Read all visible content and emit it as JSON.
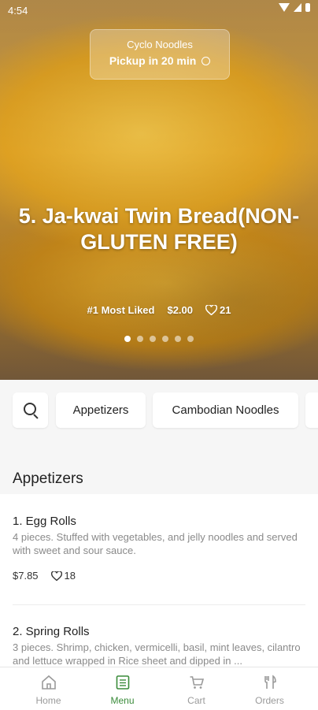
{
  "status_bar": {
    "time": "4:54"
  },
  "pickup": {
    "restaurant": "Cyclo Noodles",
    "time_label": "Pickup in 20 min"
  },
  "featured": {
    "title": "5. Ja-kwai Twin Bread(NON-GLUTEN FREE)",
    "badge": "#1 Most Liked",
    "price": "$2.00",
    "likes": "21",
    "carousel": {
      "count": 6,
      "active_index": 0
    }
  },
  "categories": {
    "items": [
      "Appetizers",
      "Cambodian Noodles"
    ]
  },
  "section": {
    "title": "Appetizers"
  },
  "menu_items": [
    {
      "name": "1. Egg Rolls",
      "description": "4 pieces. Stuffed with vegetables, and jelly noodles and served with sweet and sour sauce.",
      "price": "$7.85",
      "likes": "18"
    },
    {
      "name": "2. Spring Rolls",
      "description": "3 pieces. Shrimp, chicken, vermicelli, basil, mint leaves, cilantro and lettuce wrapped in Rice sheet and dipped in ..."
    }
  ],
  "nav": {
    "items": [
      {
        "label": "Home",
        "icon": "home-icon"
      },
      {
        "label": "Menu",
        "icon": "menu-icon"
      },
      {
        "label": "Cart",
        "icon": "cart-icon"
      },
      {
        "label": "Orders",
        "icon": "orders-icon"
      }
    ],
    "active": "Menu",
    "active_color": "#3a8b3a"
  }
}
